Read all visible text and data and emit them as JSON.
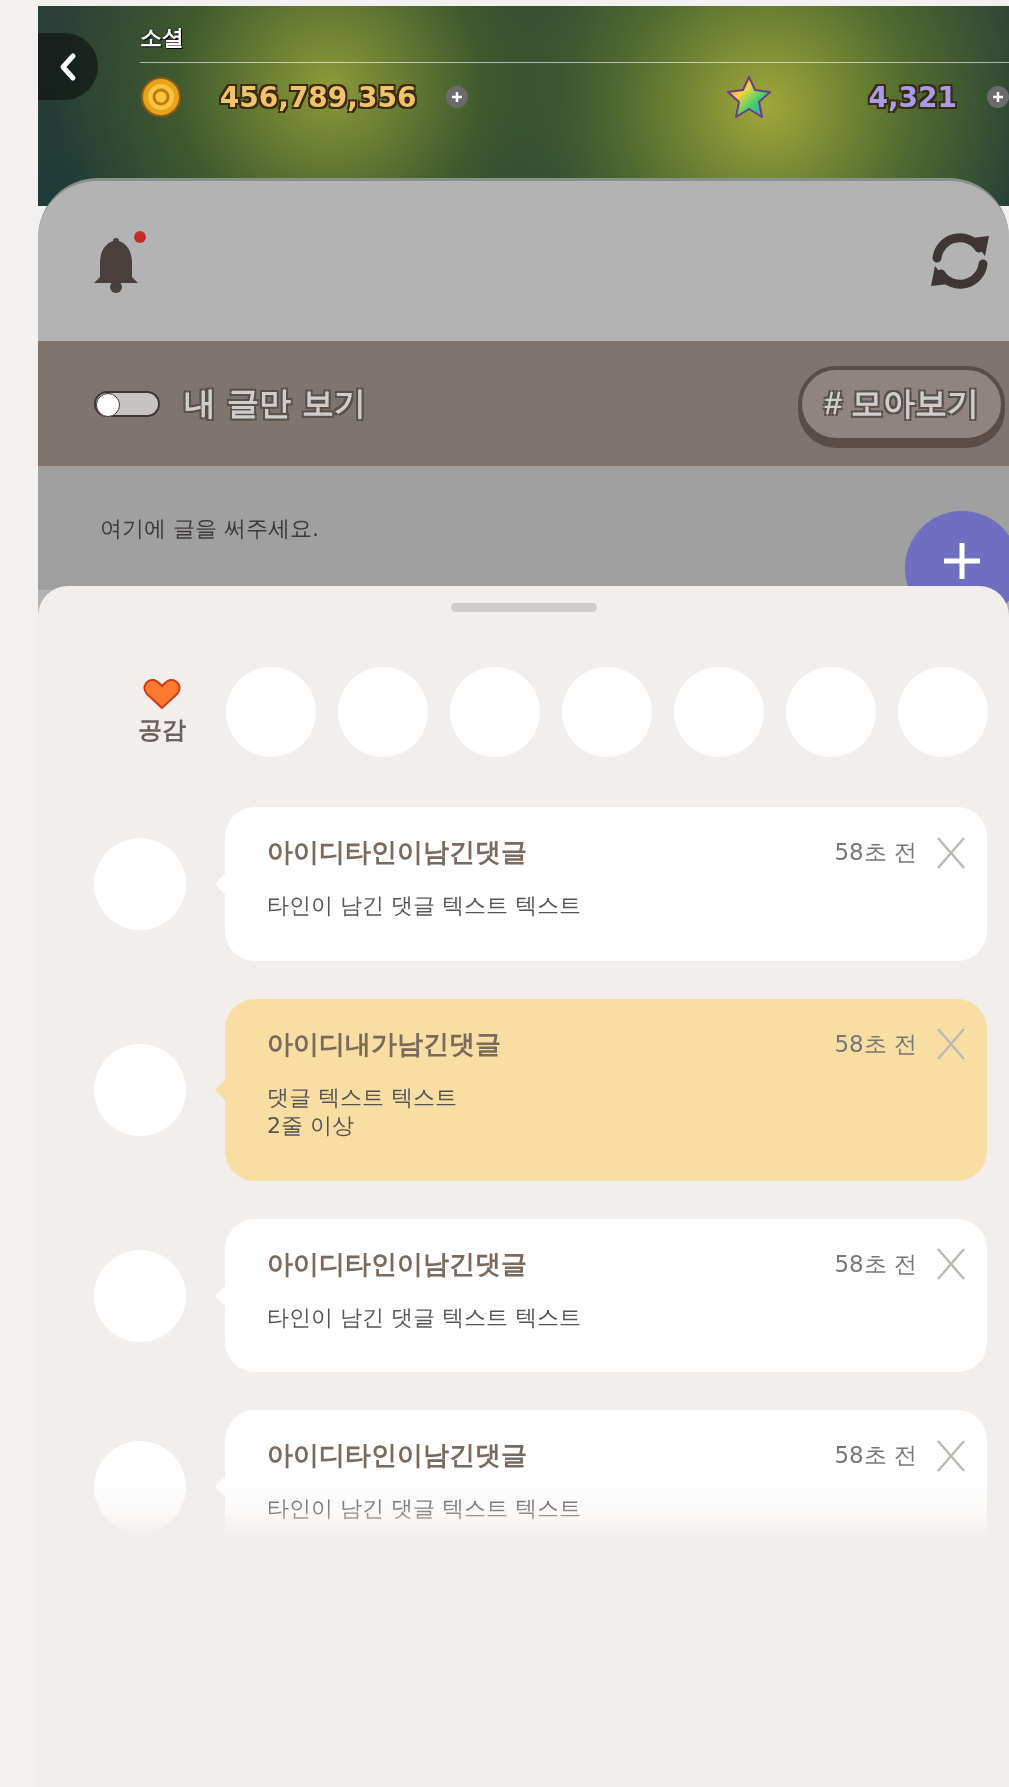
{
  "header": {
    "title": "소셜",
    "coins": "456,789,356",
    "stars": "4,321"
  },
  "toolbar": {
    "has_notification": true
  },
  "filter_bar": {
    "toggle": {
      "label": "내 글만 보기",
      "on": false
    },
    "collect_button": "# 모아보기"
  },
  "compose": {
    "placeholder": "여기에 글을 써주세요."
  },
  "reactions": {
    "label": "공감"
  },
  "comments": [
    {
      "author": "아이디타인이남긴댓글",
      "time": "58초 전",
      "text": "타인이 남긴 댓글 텍스트 텍스트",
      "mine": false
    },
    {
      "author": "아이디내가남긴댓글",
      "time": "58초 전",
      "text": "댓글 텍스트 텍스트\n2줄 이상",
      "mine": true
    },
    {
      "author": "아이디타인이남긴댓글",
      "time": "58초 전",
      "text": "타인이 남긴 댓글 텍스트 텍스트",
      "mine": false
    },
    {
      "author": "아이디타인이남긴댓글",
      "time": "58초 전",
      "text": "타인이 남긴 댓글 텍스트 텍스트",
      "mine": false
    }
  ]
}
